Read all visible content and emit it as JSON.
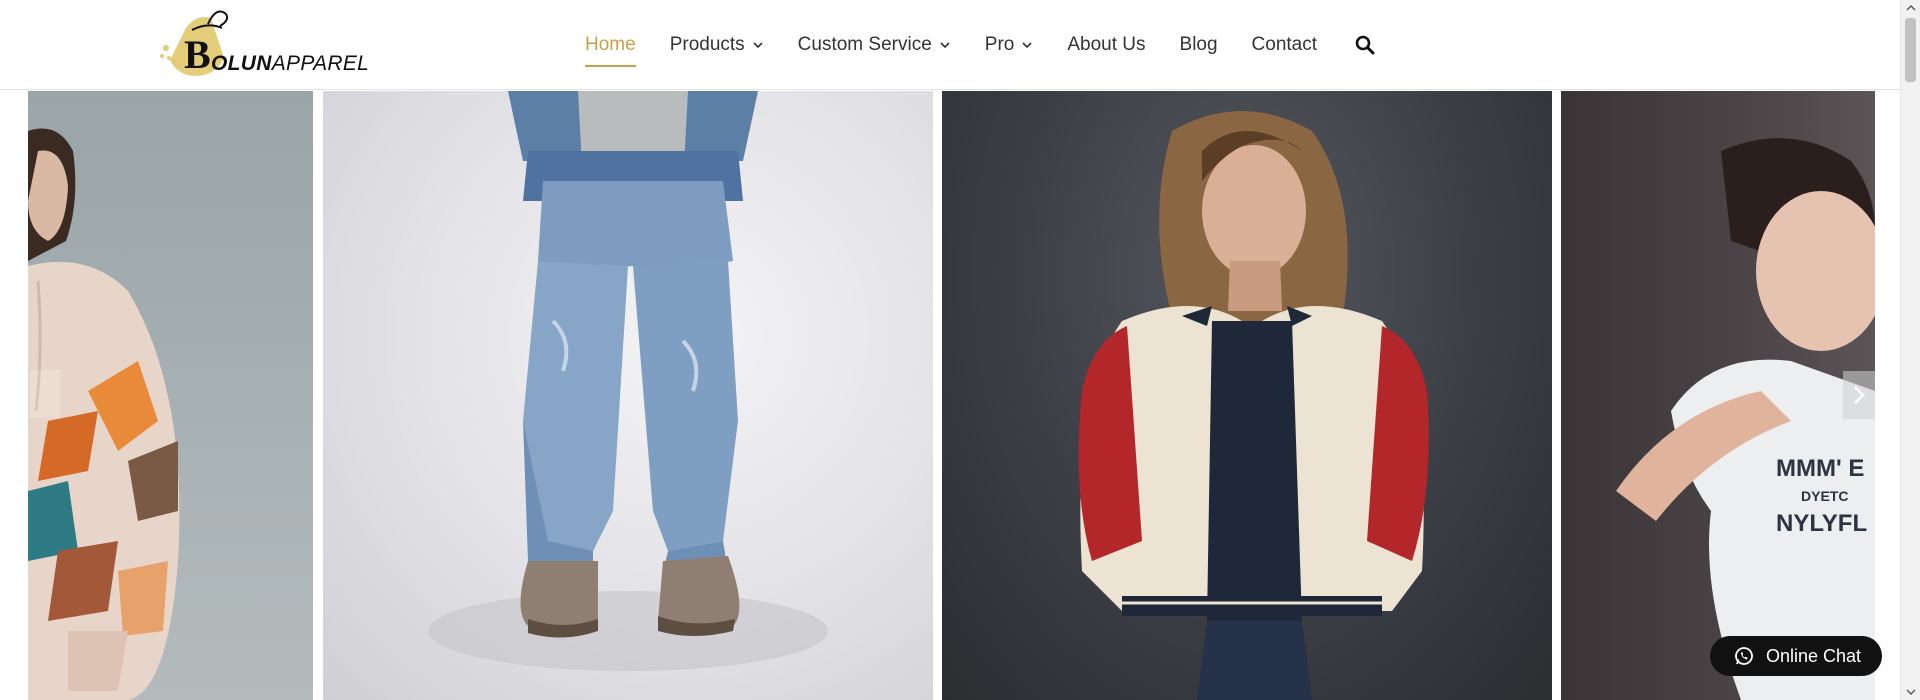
{
  "brand": {
    "logo_letter": "B",
    "logo_text_bold": "OLUN",
    "logo_text_regular": "APPAREL",
    "accent_color": "#c9a04a"
  },
  "nav": {
    "items": [
      {
        "label": "Home",
        "active": true,
        "has_dropdown": false
      },
      {
        "label": "Products",
        "active": false,
        "has_dropdown": true
      },
      {
        "label": "Custom Service",
        "active": false,
        "has_dropdown": true
      },
      {
        "label": "Pro",
        "active": false,
        "has_dropdown": true
      },
      {
        "label": "About Us",
        "active": false,
        "has_dropdown": false
      },
      {
        "label": "Blog",
        "active": false,
        "has_dropdown": false
      },
      {
        "label": "Contact",
        "active": false,
        "has_dropdown": false
      }
    ],
    "search_icon": "search-icon"
  },
  "gallery": {
    "slides": [
      {
        "subject": "hoodie-model"
      },
      {
        "subject": "jeans-model"
      },
      {
        "subject": "varsity-jacket-model"
      },
      {
        "subject": "tshirt-model",
        "shirt_print": [
          "MMM' E",
          "DYETC",
          "NYLYFL"
        ]
      }
    ]
  },
  "chat": {
    "label": "Online Chat",
    "icon": "whatsapp-icon"
  }
}
